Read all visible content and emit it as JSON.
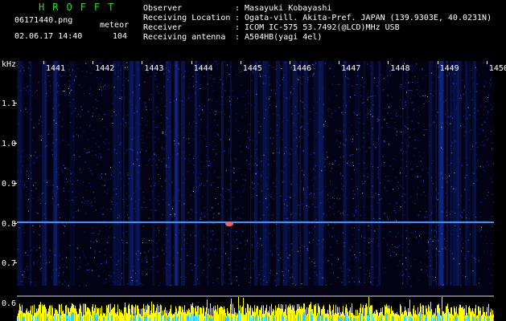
{
  "header": {
    "app_title": "HROFFT",
    "filename": "06171440.png",
    "mode_label": "meteor",
    "datetime": "02.06.17 14:40",
    "count": "104",
    "fields": [
      {
        "label": "Observer",
        "value": ": Masayuki Kobayashi"
      },
      {
        "label": "Receiving Location",
        "value": ": Ogata-vill. Akita-Pref. JAPAN (139.9303E, 40.0231N)"
      },
      {
        "label": "Receiver",
        "value": ": ICOM IC-575 53.7492(@LCD)MHz USB"
      },
      {
        "label": "Receiving antenna",
        "value": ": A504HB(yagi 4el)"
      }
    ]
  },
  "axis": {
    "unit": "kHz",
    "y_labels": [
      "1.1",
      "1.0",
      "0.9",
      "0.8",
      "0.7",
      "0.6"
    ],
    "minute_labels": [
      "1441",
      "1442",
      "1443",
      "1444",
      "1445",
      "1446",
      "1447",
      "1448",
      "1449",
      "1450"
    ]
  },
  "colors": {
    "background": "#000000",
    "waterfall_bg": "#020214",
    "signal_line": "#3399ff",
    "header_green": "#22dd22",
    "spectrum": "#ffff00"
  }
}
